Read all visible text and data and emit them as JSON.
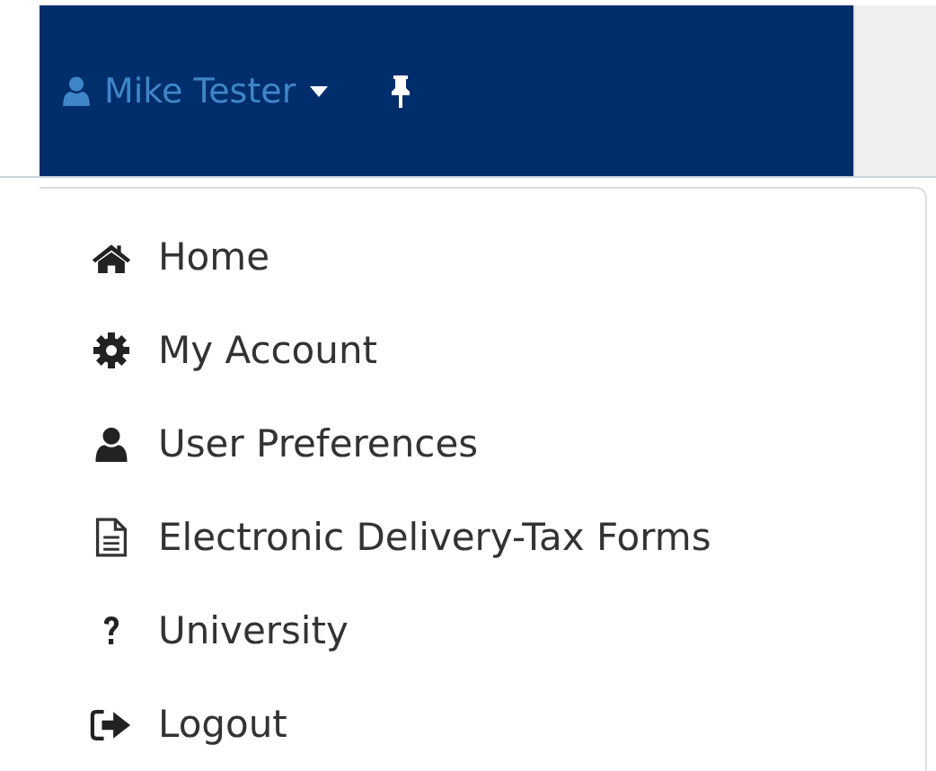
{
  "navbar": {
    "user_name": "Mike Tester",
    "pinned": true
  },
  "user_menu": {
    "expanded": true,
    "items": [
      {
        "kind": "home",
        "label": "Home"
      },
      {
        "kind": "gear",
        "label": "My Account"
      },
      {
        "kind": "user",
        "label": "User Preferences"
      },
      {
        "kind": "document",
        "label": "Electronic Delivery-Tax Forms"
      },
      {
        "kind": "help",
        "label": "University"
      },
      {
        "kind": "logout",
        "label": "Logout"
      }
    ]
  }
}
